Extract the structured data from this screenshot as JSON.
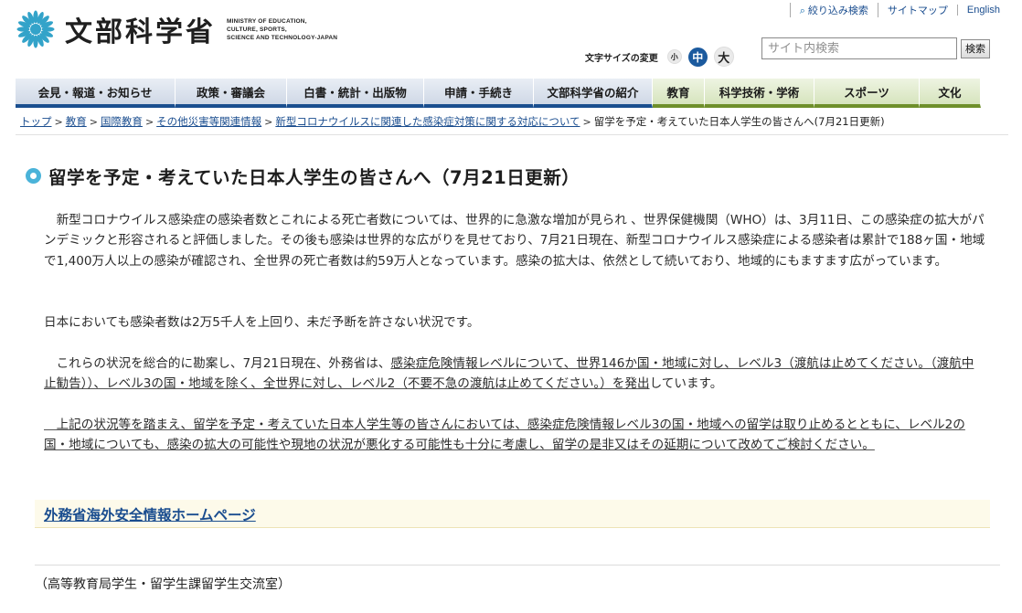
{
  "header": {
    "logo_text": "文部科学省",
    "logo_en": [
      "MINISTRY OF EDUCATION,",
      "CULTURE, SPORTS,",
      "SCIENCE AND TECHNOLOGY-JAPAN"
    ],
    "util_links": [
      {
        "label": "絞り込み検索",
        "icon": "magnifier-icon"
      },
      {
        "label": "サイトマップ"
      },
      {
        "label": "English"
      }
    ],
    "font_size_label": "文字サイズの変更",
    "font_size_small": "小",
    "font_size_mid": "中",
    "font_size_large": "大",
    "search_placeholder": "サイト内検索",
    "search_button": "検索"
  },
  "gnav": [
    {
      "label": "会見・報道・お知らせ",
      "group": "a"
    },
    {
      "label": "政策・審議会",
      "group": "a"
    },
    {
      "label": "白書・統計・出版物",
      "group": "a"
    },
    {
      "label": "申請・手続き",
      "group": "a"
    },
    {
      "label": "文部科学省の紹介",
      "group": "a"
    },
    {
      "label": "教育",
      "group": "b"
    },
    {
      "label": "科学技術・学術",
      "group": "b"
    },
    {
      "label": "スポーツ",
      "group": "b"
    },
    {
      "label": "文化",
      "group": "b"
    }
  ],
  "breadcrumb": {
    "links": [
      "トップ",
      "教育",
      "国際教育",
      "その他災害等関連情報",
      "新型コロナウイルスに関連した感染症対策に関する対応について"
    ],
    "current": "留学を予定・考えていた日本人学生の皆さんへ(7月21日更新)"
  },
  "page": {
    "title": "留学を予定・考えていた日本人学生の皆さんへ（7月21日更新）",
    "para1": "　新型コロナウイルス感染症の感染者数とこれによる死亡者数については、世界的に急激な増加が見られ 、世界保健機関（WHO）は、3月11日、この感染症の拡大がパンデミックと形容されると評価しました。その後も感染は世界的な広がりを見せており、7月21日現在、新型コロナウイルス感染症による感染者は累計で188ヶ国・地域で1,400万人以上の感染が確認され、全世界の死亡者数は約59万人となっています。感染の拡大は、依然として続いており、地域的にもますます広がっています。",
    "para2": "日本においても感染者数は2万5千人を上回り、未だ予断を許さない状況です。",
    "para3_a": "　これらの状況を総合的に勘案し、7月21日現在、外務省は、",
    "para3_u": "感染症危険情報レベルについて、世界146か国・地域に対し、レベル3（渡航は止めてください。（渡航中止勧告））、レベル3の国・地域を除く、全世界に対し、レベル2（不要不急の渡航は止めてください。）を発出",
    "para3_b": "しています。",
    "para4": "　上記の状況等を踏まえ、留学を予定・考えていた日本人学生等の皆さんにおいては、感染症危険情報レベル3の国・地域への留学は取り止めるとともに、レベル2の国・地域についても、感染の拡大の可能性や現地の状況が悪化する可能性も十分に考慮し、留学の是非又はその延期について改めてご検討ください。",
    "link_label": "外務省海外安全情報ホームページ",
    "contact": "（高等教育局学生・留学生課留学生交流室）"
  },
  "colors": {
    "nav_blue": "#1a4f8f",
    "nav_green": "#6e8f2a",
    "link": "#1a4d8f",
    "title_bullet": "#4ab3d9",
    "linkbox_bg": "#fdfaea"
  }
}
